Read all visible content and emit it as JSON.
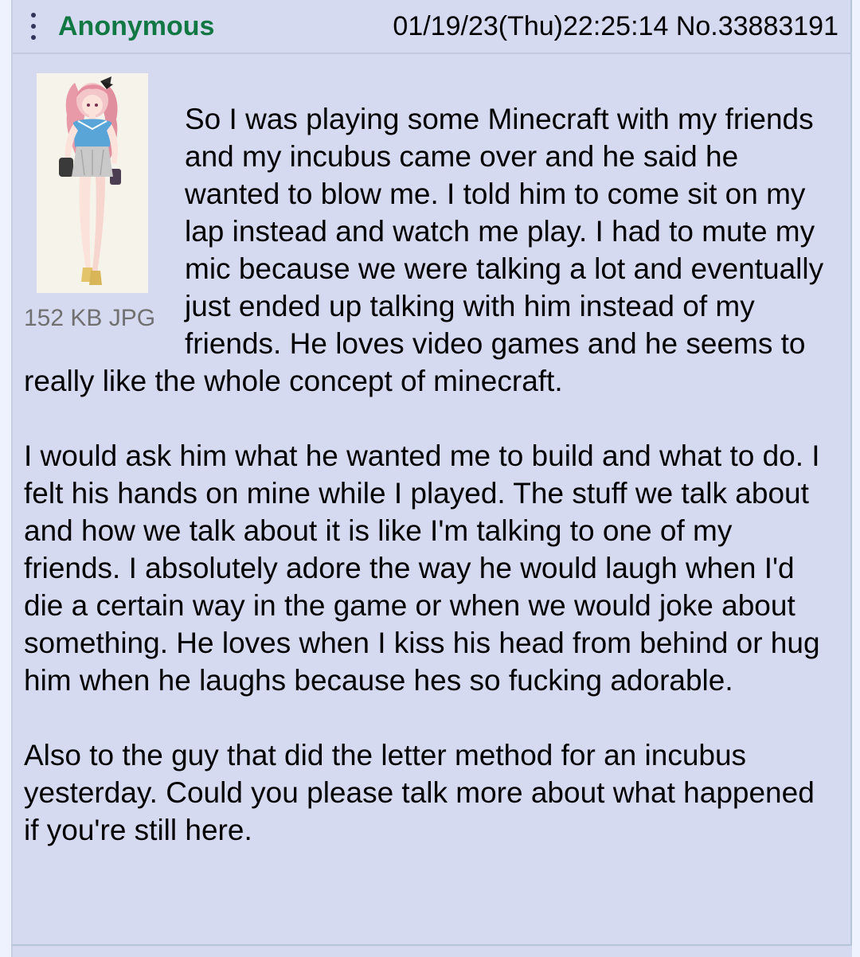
{
  "post": {
    "name": "Anonymous",
    "date": "01/19/23(Thu)22:25:14",
    "number": "No.33883191",
    "file": {
      "info": "152 KB JPG",
      "thumbnail_icon": "anime-character-thumbnail"
    },
    "paragraphs": [
      "So I was playing some Minecraft with my friends and my incubus came over and he said he wanted to blow me. I told him to come sit on my lap instead and watch me play. I had to mute my mic because we were talking a lot and eventually just ended up talking with him instead of my friends. He loves video games and he seems to really like the whole concept of minecraft.",
      "I would ask him what he wanted me to build and what to do. I felt his hands on mine while I played. The stuff we talk about and how we talk about it is like I'm talking to one of my friends. I absolutely adore the way he would laugh when I'd die a certain way in the game or when we would joke about something. He loves when I kiss his head from behind or hug him when he laughs because hes so fucking adorable.",
      "Also to the guy that did the letter method for an incubus yesterday. Could you please talk more about what happened if you're still here."
    ]
  },
  "colors": {
    "post_bg": "#d6daf0",
    "name_green": "#117743",
    "fileinfo_gray": "#707070",
    "border": "#b7c5d9"
  }
}
